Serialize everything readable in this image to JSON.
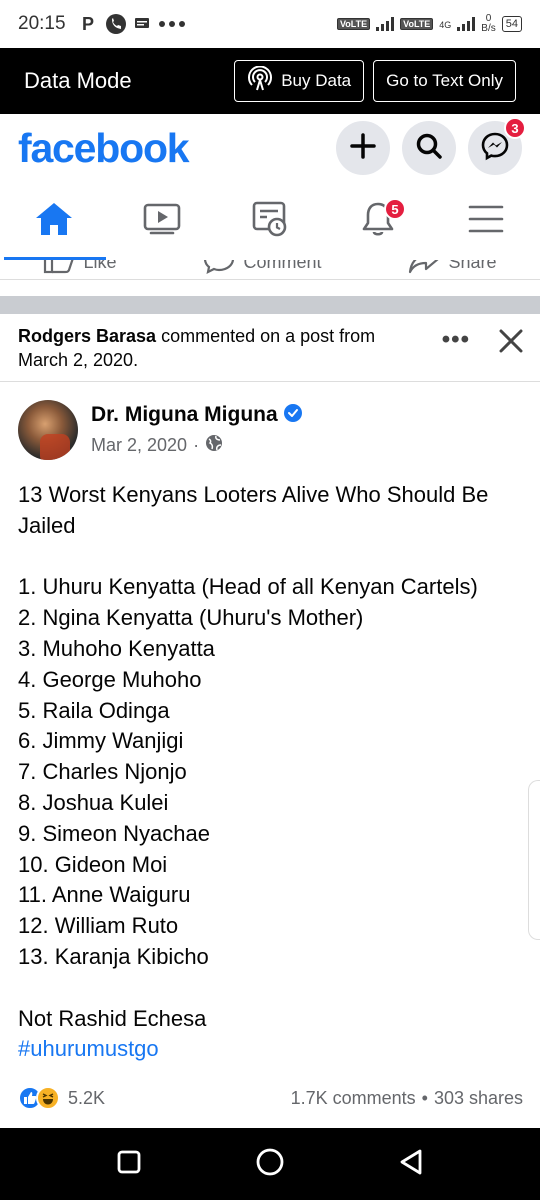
{
  "status_bar": {
    "time": "20:15",
    "network_type": "4G",
    "volte_1": "VoLTE",
    "volte_2": "VoLTE",
    "speed_value": "0",
    "speed_unit": "B/s",
    "battery": "54"
  },
  "data_mode": {
    "title": "Data Mode",
    "buy_data_label": "Buy Data",
    "text_only_label": "Go to Text Only"
  },
  "header": {
    "logo": "facebook",
    "messenger_badge": "3"
  },
  "nav": {
    "notifications_badge": "5"
  },
  "prev_actions": {
    "like": "Like",
    "comment": "Comment",
    "share": "Share"
  },
  "activity": {
    "actor": "Rodgers Barasa",
    "text": " commented on a post from March 2, 2020."
  },
  "post": {
    "author": "Dr. Miguna Miguna",
    "date": "Mar 2, 2020",
    "date_sep": "·",
    "title": "13 Worst Kenyans Looters Alive Who Should Be Jailed",
    "list": [
      "1. Uhuru Kenyatta (Head of all Kenyan Cartels)",
      "2. Ngina Kenyatta (Uhuru's Mother)",
      "3. Muhoho Kenyatta",
      "4. George Muhoho",
      "5. Raila Odinga",
      "6. Jimmy Wanjigi",
      "7. Charles Njonjo",
      "8. Joshua Kulei",
      "9. Simeon Nyachae",
      "10. Gideon Moi",
      "11. Anne Waiguru",
      "12. William Ruto",
      "13. Karanja Kibicho"
    ],
    "footer_line": "Not Rashid Echesa",
    "hashtag": "#uhurumustgo",
    "reaction_count": "5.2K",
    "comments": "1.7K comments",
    "dot": "•",
    "shares": "303 shares"
  },
  "colors": {
    "brand": "#1877f2",
    "badge": "#e41e3f"
  }
}
